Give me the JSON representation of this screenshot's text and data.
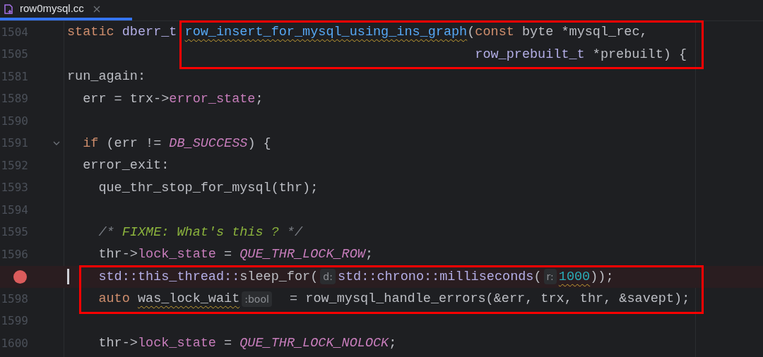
{
  "tab": {
    "title": "row0mysql.cc",
    "selected": true
  },
  "lines": [
    {
      "number": "1504",
      "boxed": true,
      "tokens": [
        {
          "text": "static ",
          "kind": "keyword"
        },
        {
          "text": "dberr_t ",
          "kind": "type"
        },
        {
          "text": "row_insert_for_mysql_using_ins_graph",
          "kind": "function",
          "squiggle": true
        },
        {
          "text": "(",
          "kind": "plain"
        },
        {
          "text": "const ",
          "kind": "keyword"
        },
        {
          "text": "byte *mysql_rec,",
          "kind": "plain"
        }
      ]
    },
    {
      "number": "1505",
      "boxed": true,
      "continuation": true,
      "tokens": [
        {
          "text": "row_prebuilt_t ",
          "kind": "type"
        },
        {
          "text": "*prebuilt) {",
          "kind": "plain"
        }
      ]
    },
    {
      "number": "1581",
      "tokens": [
        {
          "text": "run_again:",
          "kind": "plain"
        }
      ]
    },
    {
      "number": "1589",
      "tokens": [
        {
          "text": "  err = trx->",
          "kind": "plain"
        },
        {
          "text": "error_state",
          "kind": "field"
        },
        {
          "text": ";",
          "kind": "plain"
        }
      ]
    },
    {
      "number": "1590"
    },
    {
      "number": "1591",
      "foldable": true,
      "tokens": [
        {
          "text": "  if ",
          "kind": "keyword"
        },
        {
          "text": "(err != ",
          "kind": "plain"
        },
        {
          "text": "DB_SUCCESS",
          "kind": "macro"
        },
        {
          "text": ") {",
          "kind": "plain"
        }
      ]
    },
    {
      "number": "1592",
      "tokens": [
        {
          "text": "  error_exit:",
          "kind": "plain"
        }
      ]
    },
    {
      "number": "1593",
      "tokens": [
        {
          "text": "    que_thr_stop_for_mysql(thr);",
          "kind": "plain"
        }
      ]
    },
    {
      "number": "1594"
    },
    {
      "number": "1595",
      "tokens": [
        {
          "text": "    /* ",
          "kind": "comment"
        },
        {
          "text": "FIXME: What's this ?",
          "kind": "todo"
        },
        {
          "text": " */",
          "kind": "comment"
        }
      ]
    },
    {
      "number": "1596",
      "tokens": [
        {
          "text": "    thr->",
          "kind": "plain"
        },
        {
          "text": "lock_state",
          "kind": "field"
        },
        {
          "text": " = ",
          "kind": "plain"
        },
        {
          "text": "QUE_THR_LOCK_ROW",
          "kind": "macro"
        },
        {
          "text": ";",
          "kind": "plain"
        }
      ]
    },
    {
      "breakpoint": true,
      "cursor": true,
      "boxed": true,
      "tokens": [
        {
          "text": "    std::this_thread::",
          "kind": "type"
        },
        {
          "text": "sleep_for(",
          "kind": "plain"
        },
        {
          "text": "d:",
          "kind": "hint"
        },
        {
          "text": "std::chrono::milliseconds",
          "kind": "type"
        },
        {
          "text": "(",
          "kind": "plain"
        },
        {
          "text": "r:",
          "kind": "hint"
        },
        {
          "text": "1000",
          "kind": "number",
          "squiggle": true
        },
        {
          "text": "));",
          "kind": "plain"
        }
      ]
    },
    {
      "number": "1598",
      "boxed": true,
      "tokens": [
        {
          "text": "    auto ",
          "kind": "keyword"
        },
        {
          "text": "was_lock_wait",
          "kind": "plain",
          "squiggle": true
        },
        {
          "text": ":bool",
          "kind": "hint"
        },
        {
          "text": "  = row_mysql_handle_errors(&err, trx, thr, &savept);",
          "kind": "plain"
        }
      ]
    },
    {
      "number": "1599"
    },
    {
      "number": "1600",
      "tokens": [
        {
          "text": "    thr->",
          "kind": "plain"
        },
        {
          "text": "lock_state",
          "kind": "field"
        },
        {
          "text": " = ",
          "kind": "plain"
        },
        {
          "text": "QUE_THR_LOCK_NOLOCK",
          "kind": "macro"
        },
        {
          "text": ";",
          "kind": "plain"
        }
      ]
    }
  ]
}
